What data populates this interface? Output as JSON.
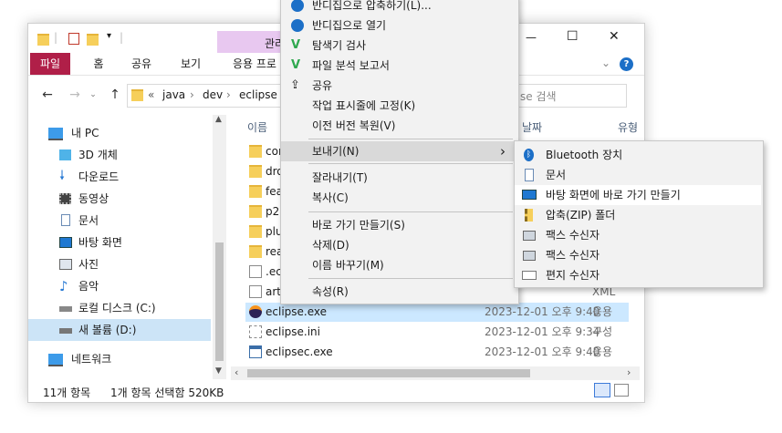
{
  "window": {
    "qat_separator": "|",
    "ribbon_context_tab": "관리",
    "tabs": [
      "파일",
      "홈",
      "공유",
      "보기",
      "응용 프로그램 도구"
    ],
    "tabs_visible": [
      "파일",
      "홈",
      "공유",
      "보기",
      "응용 프로"
    ],
    "minimize": "—",
    "maximize": "☐",
    "close": "✕",
    "help": "?"
  },
  "address": {
    "back": "←",
    "forward": "→",
    "up": "↑",
    "overflow": "«",
    "crumbs": [
      "java",
      "dev",
      "eclipse"
    ],
    "search_placeholder": "se 검색"
  },
  "sidebar": {
    "items": [
      {
        "label": "내 PC",
        "icon": "pc-icon"
      },
      {
        "label": "3D 개체",
        "icon": "3d-objects-icon"
      },
      {
        "label": "다운로드",
        "icon": "download-icon"
      },
      {
        "label": "동영상",
        "icon": "video-icon"
      },
      {
        "label": "문서",
        "icon": "document-icon"
      },
      {
        "label": "바탕 화면",
        "icon": "desktop-icon"
      },
      {
        "label": "사진",
        "icon": "picture-icon"
      },
      {
        "label": "음악",
        "icon": "music-icon"
      },
      {
        "label": "로컬 디스크 (C:)",
        "icon": "disk-icon"
      },
      {
        "label": "새 볼륨 (D:)",
        "icon": "disk-icon"
      },
      {
        "label": "네트워크",
        "icon": "network-icon"
      }
    ]
  },
  "columns": {
    "name": "이름",
    "date": "날짜",
    "type": "유형"
  },
  "files": [
    {
      "name": "con",
      "kind": "folder",
      "date": "",
      "type": ""
    },
    {
      "name": "dro",
      "kind": "folder",
      "date": "",
      "type": ""
    },
    {
      "name": "fea",
      "kind": "folder",
      "date": "",
      "type": ""
    },
    {
      "name": "p2",
      "kind": "folder",
      "date": "",
      "type": ""
    },
    {
      "name": "plu",
      "kind": "folder",
      "date": "",
      "type": ""
    },
    {
      "name": "rea",
      "kind": "folder",
      "date": "",
      "type": ""
    },
    {
      "name": ".ec",
      "kind": "doc",
      "date": "",
      "type": ""
    },
    {
      "name": "arti",
      "kind": "doc",
      "date": "",
      "type": "XML"
    },
    {
      "name": "eclipse.exe",
      "kind": "exe",
      "date": "2023-12-01 오후 9:40",
      "type": "응용"
    },
    {
      "name": "eclipse.ini",
      "kind": "ini",
      "date": "2023-12-01 오후 9:34",
      "type": "구성"
    },
    {
      "name": "eclipsec.exe",
      "kind": "exe2",
      "date": "2023-12-01 오후 9:40",
      "type": "응용"
    }
  ],
  "status": {
    "count": "11개 항목",
    "selection": "1개 항목 선택함 520KB"
  },
  "context_menu": {
    "items": [
      {
        "label": "반디집으로 압축하기(L)...",
        "icon": "bandizip-icon"
      },
      {
        "label": "반디집으로 열기",
        "icon": "bandizip-icon"
      },
      {
        "label": "탐색기 검사",
        "icon": "v3-scan-icon"
      },
      {
        "label": "파일 분석 보고서",
        "icon": "v3-report-icon"
      },
      {
        "label": "공유",
        "icon": "share-icon"
      },
      {
        "label": "작업 표시줄에 고정(K)",
        "icon": ""
      },
      {
        "label": "이전 버전 복원(V)",
        "icon": ""
      },
      {
        "label": "보내기(N)",
        "icon": "",
        "submenu": true
      },
      {
        "label": "잘라내기(T)",
        "icon": ""
      },
      {
        "label": "복사(C)",
        "icon": ""
      },
      {
        "label": "바로 가기 만들기(S)",
        "icon": ""
      },
      {
        "label": "삭제(D)",
        "icon": ""
      },
      {
        "label": "이름 바꾸기(M)",
        "icon": ""
      },
      {
        "label": "속성(R)",
        "icon": ""
      }
    ],
    "submenu_arrow": "›"
  },
  "send_to_menu": {
    "items": [
      {
        "label": "Bluetooth 장치",
        "icon": "bluetooth-icon"
      },
      {
        "label": "문서",
        "icon": "document-icon"
      },
      {
        "label": "바탕 화면에 바로 가기 만들기",
        "icon": "desktop-icon"
      },
      {
        "label": "압축(ZIP) 폴더",
        "icon": "zip-folder-icon"
      },
      {
        "label": "팩스 수신자",
        "icon": "fax-icon"
      },
      {
        "label": "팩스 수신자",
        "icon": "fax-icon"
      },
      {
        "label": "편지 수신자",
        "icon": "mail-icon"
      }
    ]
  }
}
